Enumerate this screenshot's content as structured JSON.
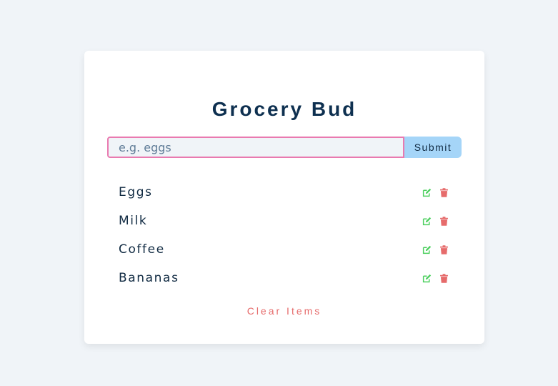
{
  "app": {
    "title": "Grocery Bud"
  },
  "form": {
    "placeholder": "e.g. eggs",
    "value": "",
    "submit_label": "Submit"
  },
  "items": [
    {
      "name": "Eggs",
      "edit_icon": "edit-icon",
      "delete_icon": "trash-icon"
    },
    {
      "name": "Milk",
      "edit_icon": "edit-icon",
      "delete_icon": "trash-icon"
    },
    {
      "name": "Coffee",
      "edit_icon": "edit-icon",
      "delete_icon": "trash-icon"
    },
    {
      "name": "Bananas",
      "edit_icon": "edit-icon",
      "delete_icon": "trash-icon"
    }
  ],
  "clear_label": "Clear Items",
  "colors": {
    "background": "#f0f4f8",
    "card": "#ffffff",
    "title": "#0e3050",
    "input_border": "#e97ab0",
    "submit_bg": "#a5d5f8",
    "edit_icon": "#4ccf5e",
    "delete_icon": "#e66b6b",
    "clear_text": "#e66b6b"
  }
}
